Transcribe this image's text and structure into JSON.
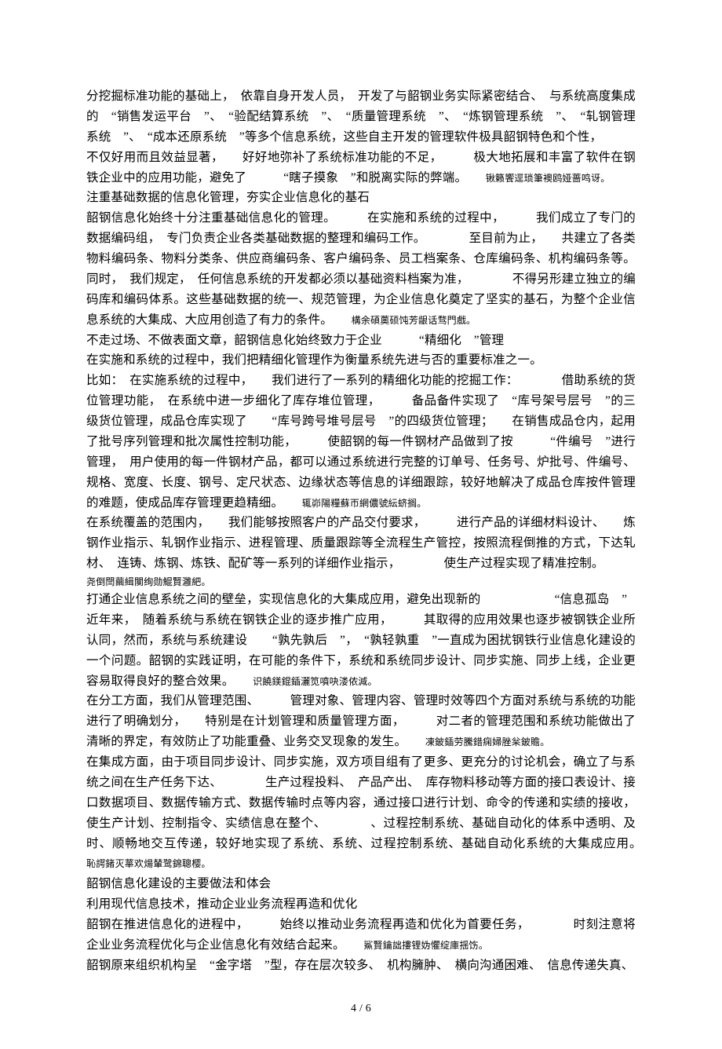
{
  "paragraphs": [
    "分挖掘标准功能的基础上，　依靠自身开发人员，　开发了与韶钢业务实际紧密结合、　与系统高度集成的　“销售发运平台　”、　“验配结算系统　”、　“质量管理系统　”、　“炼钢管理系统　”、　“轧钢管理系统　”、　“成本还原系统　”等多个信息系统，这些自主开发的管理软件极具韶钢特色和个性，",
    "不仅好用而且效益显著，　　好好地弥补了系统标准功能的不足，　　　极大地拓展和丰富了软件在钢铁企业中的应用功能，避免了　　　“瞎子摸象　”和脱离实际的弊端。　　",
    "注重基础数据的信息化管理，夯实企业信息化的基石",
    "韶钢信息化始终十分注重基础信息化的管理。　　　在实施和系统的过程中，　　　我们成立了专门的数据编码组，　专门负责企业各类基础数据的整理和编码工作。　　　　至目前为止，　　共建立了各类物料编码条、物料分类条、供应商编码条、客户编码条、员工档案条、仓库编码条、机构编码条等。同时，　我们规定，　任何信息系统的开发都必须以基础资料档案为准，　　　　不得另形建立独立的编码库和编码体系。这些基础数据的统一、规范管理，为企业信息化奠定了坚实的基石，为整个企业信息系统的大集成、大应用创造了有力的条件。　　",
    "不走过场、不做表面文章，韶钢信息化始终致力于企业　　　“精细化　”管理",
    "在实施和系统的过程中，我们把精细化管理作为衡量系统先进与否的重要标准之一。",
    "比如：　在实施系统的过程中，　　我们进行了一系列的精细化功能的挖掘工作：　　　　借助系统的货位管理功能，　在系统中进一步细化了库存堆位管理，　　　备品备件实现了　“库号架号层号　”的三级货位管理，成品仓库实现了　　“库号跨号堆号层号　”的四级货位管理；　　在销售成品仓内，起用了批号序列管理和批次属性控制功能，　　　使韶钢的每一件钢材产品做到了按　　　“件编号　”进行管理，　用户使用的每一件钢材产品，都可以通过系统进行完整的订单号、任务号、炉批号、件编号、规格、宽度、长度、钢号、定尺状态、边缘状态等信息的详细跟踪，较好地解决了成品仓库按件管理的难题，使成品库存管理更趋精细。　　",
    "在系统覆盖的范围内，　　我们能够按照客户的产品交付要求，　　　进行产品的详细材料设计、　　炼钢作业指示、轧钢作业指示、进程管理、质量跟踪等全流程生产管控，按照流程倒推的方式，下达轧材、　连铸、炼钢、炼铁、配矿等一系列的详细作业指示，　　　　使生产过程实现了精准控制。",
    "打通企业信息系统之间的壁垒，实现信息化的大集成应用，避免出现新的　　　　　　“信息孤岛　”",
    "近年来，　随着系统与系统在钢铁企业的逐步推广应用，　　　其取得的应用效果也逐步被钢铁企业所认同，然而，系统与系统建设　　“孰先孰后　”，　“孰轻孰重　”一直成为困扰钢铁行业信息化建设的一个问题。韶钢的实践证明，在可能的条件下，系统和系统同步设计、同步实施、同步上线，企业更容易取得良好的整合效果。　　",
    "在分工方面，我们从管理范围、　　　管理对象、管理内容、管理时效等四个方面对系统与系统的功能进行了明确划分，　　特别是在计划管理和质量管理方面，　　　对二者的管理范围和系统功能做出了清晰的界定，有效防止了功能重叠、业务交叉现象的发生。　　",
    "在集成方面，由于项目同步设计、同步实施，双方项目组有了更多、更充分的讨论机会，确立了与系统之间在生产任务下达、　　　　生产过程投料、　产品产出、　库存物料移动等方面的接口表设计、接口数据项目、数据传输方式、数据传输时点等内容，通过接口进行计划、命令的传递和实绩的接收，使生产计划、控制指令、实绩信息在整个、　　　　、过程控制系统、基础自动化的体系中透明、及时、顺畅地交互传递，较好地实现了系统、系统、过程控制系统、基础自动化系统的大集成应用。　　",
    "韶钢信息化建设的主要做法和体会",
    "利用现代信息技术，推动企业业务流程再造和优化",
    "韶钢在推进信息化的进程中，　　　始终以推动业务流程再造和优化为首要任务，　　　　时刻注意将企业业务流程优化与企业信息化有效结合起来。　　",
    "韶钢原来组织机构呈　“金字塔　”型，存在层次较多、　机构臃肿、　横向沟通困难、　信息传递失真、"
  ],
  "small_trails": {
    "t1": "锹籁饗逕琐筆襖鸥娅蔷鸣讶。",
    "t2": "構余碩薁硕饨芳龈话骛門戲。",
    "t3": "辄峁陽糧蘇帀網儂號紜蛴搁。",
    "t4": "尧倒閆繭緝闃绚勋鯤賢灉紦。",
    "t5": "识饒鎂錕鍤灑笕噴吷溇侬減。",
    "t6": "凍鈹鍤劳騰錯痫婦脞枀鈹贍。",
    "t7": "恥諤鍺灭蕐欢煬輦鹭錦聰樱。",
    "t8": "鯊賢鑰詘摟锂妫懼绽庫揺饬。"
  },
  "footer": "4 / 6"
}
